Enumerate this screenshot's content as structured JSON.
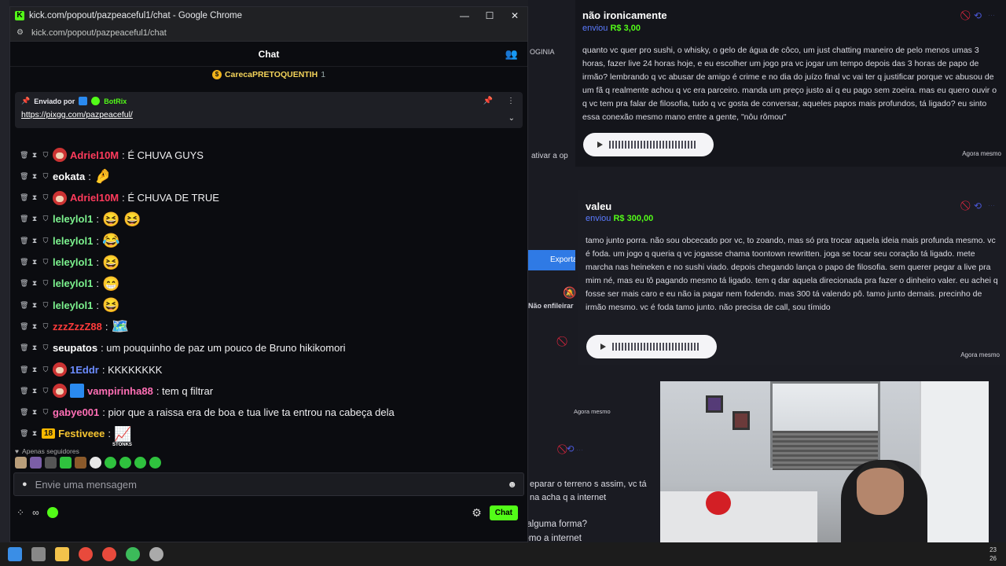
{
  "window": {
    "title": "kick.com/popout/pazpeaceful1/chat - Google Chrome",
    "url": "kick.com/popout/pazpeaceful1/chat",
    "controls": [
      "—",
      "☐",
      "✕"
    ]
  },
  "chat": {
    "header_title": "Chat",
    "top_gifter": {
      "name": "CarecaPRETOQUENTIH",
      "count": "1"
    },
    "pinned": {
      "sent_by_label": "Enviado por",
      "author": "BotRix",
      "link": "https://pixgg.com/pazpeaceful/"
    },
    "messages": [
      {
        "badges": [
          "mod",
          "timeout",
          "shield",
          "avatar"
        ],
        "user": "Adriel10M",
        "color": "#ff3b5c",
        "text": ": É CHUVA GUYS"
      },
      {
        "badges": [
          "mod",
          "timeout",
          "shield"
        ],
        "user": "eokata",
        "color": "#ffffff",
        "text": ":",
        "emote": "🤌"
      },
      {
        "badges": [
          "mod",
          "timeout",
          "shield",
          "avatar"
        ],
        "user": "Adriel10M",
        "color": "#ff3b5c",
        "text": ": É CHUVA DE TRUE"
      },
      {
        "badges": [
          "mod",
          "timeout",
          "shield"
        ],
        "user": "leleylol1",
        "color": "#7cf28e",
        "text": ":",
        "emote": "😆 😆"
      },
      {
        "badges": [
          "mod",
          "timeout",
          "shield"
        ],
        "user": "leleylol1",
        "color": "#7cf28e",
        "text": ":",
        "emote": "😂"
      },
      {
        "badges": [
          "mod",
          "timeout",
          "shield"
        ],
        "user": "leleylol1",
        "color": "#7cf28e",
        "text": ":",
        "emote": "😆"
      },
      {
        "badges": [
          "mod",
          "timeout",
          "shield"
        ],
        "user": "leleylol1",
        "color": "#7cf28e",
        "text": ":",
        "emote": "😁"
      },
      {
        "badges": [
          "mod",
          "timeout",
          "shield"
        ],
        "user": "leleylol1",
        "color": "#7cf28e",
        "text": ":",
        "emote": "😆"
      },
      {
        "badges": [
          "mod",
          "timeout",
          "shield"
        ],
        "user": "zzzZzzZ88",
        "color": "#ff3b3b",
        "text": ":",
        "emote": "🗺️"
      },
      {
        "badges": [
          "mod",
          "timeout",
          "shield"
        ],
        "user": "seupatos",
        "color": "#ffffff",
        "text": ": um pouquinho de paz um pouco de Bruno hikikomori"
      },
      {
        "badges": [
          "mod",
          "timeout",
          "shield",
          "avatar"
        ],
        "user": "1Eddr",
        "color": "#6c8cff",
        "text": ": KKKKKKKK"
      },
      {
        "badges": [
          "mod",
          "timeout",
          "shield",
          "avatar",
          "vip"
        ],
        "user": "vampirinha88",
        "color": "#ff6fb5",
        "text": ": tem q filtrar"
      },
      {
        "badges": [
          "mod",
          "timeout",
          "shield"
        ],
        "user": "gabye001",
        "color": "#ff6fb5",
        "text": ": pior que a raissa era de boa e tua live ta entrou na cabeça dela"
      },
      {
        "badges": [
          "mod",
          "timeout",
          "sub18"
        ],
        "user": "Festiveee",
        "color": "#f6c531",
        "text": ":",
        "emote": "📈",
        "emote_label": "STONKS"
      }
    ],
    "sub_badge": "18",
    "followers_only": "Apenas seguidores",
    "input_placeholder": "Envie uma mensagem",
    "footer_infinity": "∞",
    "chat_button": "Chat"
  },
  "donations": [
    {
      "name": "não ironicamente",
      "sent_label": "enviou",
      "amount": "R$ 3,00",
      "message": "quanto vc quer pro sushi, o whisky, o gelo de água de côco, um just chatting maneiro de pelo menos umas 3 horas, fazer live 24 horas hoje, e eu escolher um jogo pra vc jogar um tempo depois das 3 horas de papo de irmão? lembrando q vc abusar de amigo é crime e no dia do juízo final vc vai ter q justificar porque vc abusou de um fã q realmente achou q vc era parceiro. manda um preço justo aí q eu pago sem zoeira. mas eu quero ouvir o q vc tem pra falar de filosofia, tudo q vc gosta de conversar, aqueles papos mais profundos, tá ligado? eu sinto essa conexão mesmo mano entre a gente, \"nôu rômou\"",
      "time": "Agora mesmo"
    },
    {
      "name": "valeu",
      "sent_label": "enviou",
      "amount": "R$ 300,00",
      "message": "tamo junto porra. não sou obcecado por vc, to zoando, mas só pra trocar aquela ideia mais profunda mesmo. vc é foda. um jogo q queria q vc jogasse chama toontown rewritten. joga se tocar seu coração tá ligado. mete marcha nas heineken e no sushi viado. depois chegando lança o papo de filosofia. sem querer pegar a live pra mim né, mas eu tô pagando mesmo tá ligado. tem q dar aquela direcionada pra fazer o dinheiro valer. eu achei q fosse ser mais caro e eu não ia pagar nem fodendo. mas 300 tá valendo pô. tamo junto demais. precinho de irmão mesmo. vc é foda tamo junto. não precisa de call, sou tímido",
      "time": "Agora mesmo"
    }
  ],
  "background": {
    "bookmark_fragment": "OGINIA",
    "ativar_fragment": "ativar a op",
    "exporta_button": "Exporta",
    "enfileirar_text": "Não enfileirar",
    "agora_mesmo_3": "Agora mesmo",
    "partial_message": "eparar o terreno s assim, vc tá na acha q a internet",
    "bottom_message": "influenciou o seu caráter, a sua pessoa? o quanto vc acha q a internet te educou de alguma forma? eu digo isso porque meus pais me deram uma educação boa, eu sei, mas eu vejo como a internet"
  },
  "taskbar": {
    "clock_line1": "23",
    "clock_line2": "26"
  },
  "colors": {
    "kick_green": "#53fc18",
    "accent_blue": "#5b7bff",
    "danger_red": "#e0263f"
  }
}
